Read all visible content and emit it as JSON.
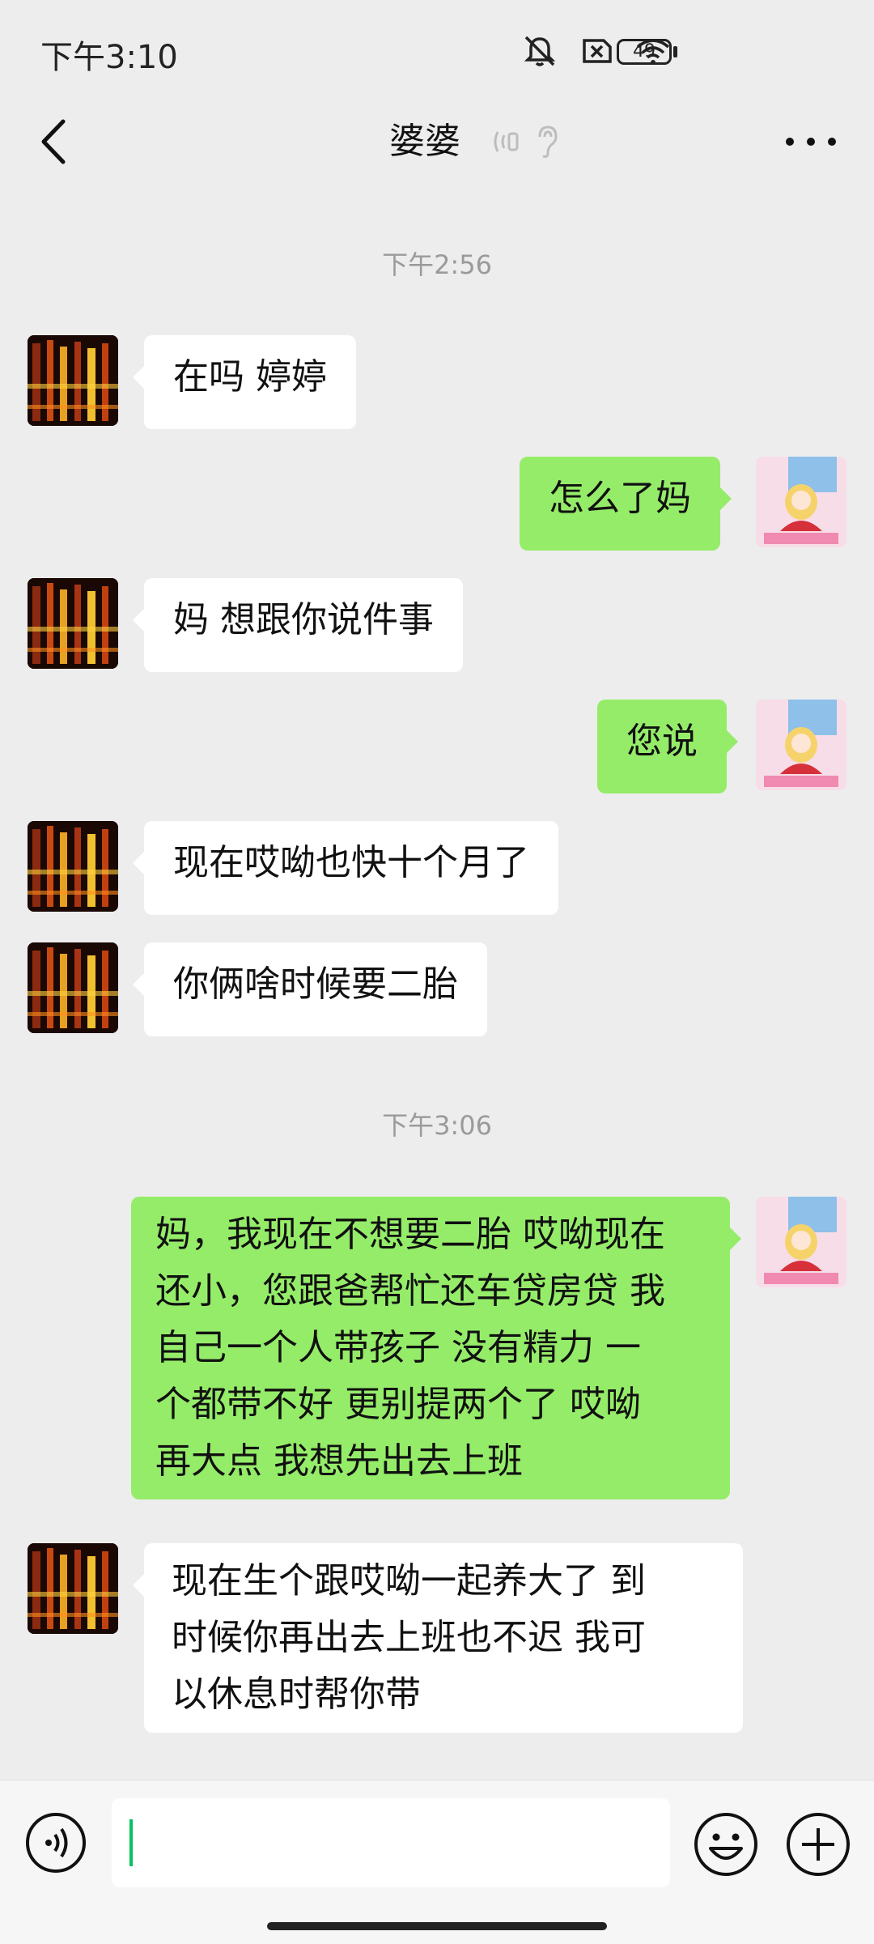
{
  "status_bar": {
    "time": "下午3:10",
    "battery": "49",
    "icons": [
      "bell-muted-icon",
      "sim-blocked-icon",
      "wifi-icon",
      "battery-icon"
    ]
  },
  "header": {
    "title": "婆婆",
    "icons": [
      "back-arrow-icon",
      "earpiece-icon",
      "ear-icon",
      "more-icon"
    ]
  },
  "messages": [
    {
      "type": "time",
      "text": "下午2:56"
    },
    {
      "side": "left",
      "text": "在吗 婷婷"
    },
    {
      "side": "right",
      "text": "怎么了妈"
    },
    {
      "side": "left",
      "text": "妈 想跟你说件事"
    },
    {
      "side": "right",
      "text": "您说"
    },
    {
      "side": "left",
      "text": "现在哎呦也快十个月了"
    },
    {
      "side": "left",
      "text": "你俩啥时候要二胎"
    },
    {
      "type": "time",
      "text": "下午3:06"
    },
    {
      "side": "right",
      "lines": [
        "妈，我现在不想要二胎  哎呦现在",
        "还小，您跟爸帮忙还车贷房贷 我",
        "自己一个人带孩子 没有精力  一",
        "个都带不好  更别提两个了  哎呦",
        "再大点  我想先出去上班"
      ]
    },
    {
      "side": "left",
      "lines": [
        "现在生个跟哎呦一起养大了    到",
        "时候你再出去上班也不迟    我可",
        "以休息时帮你带"
      ]
    }
  ],
  "input_bar": {
    "value": "",
    "icons": [
      "voice-icon",
      "emoji-icon",
      "plus-icon"
    ]
  },
  "colors": {
    "background": "#ededed",
    "sent_bubble": "#95ec69",
    "received_bubble": "#ffffff",
    "caret": "#07c160"
  }
}
